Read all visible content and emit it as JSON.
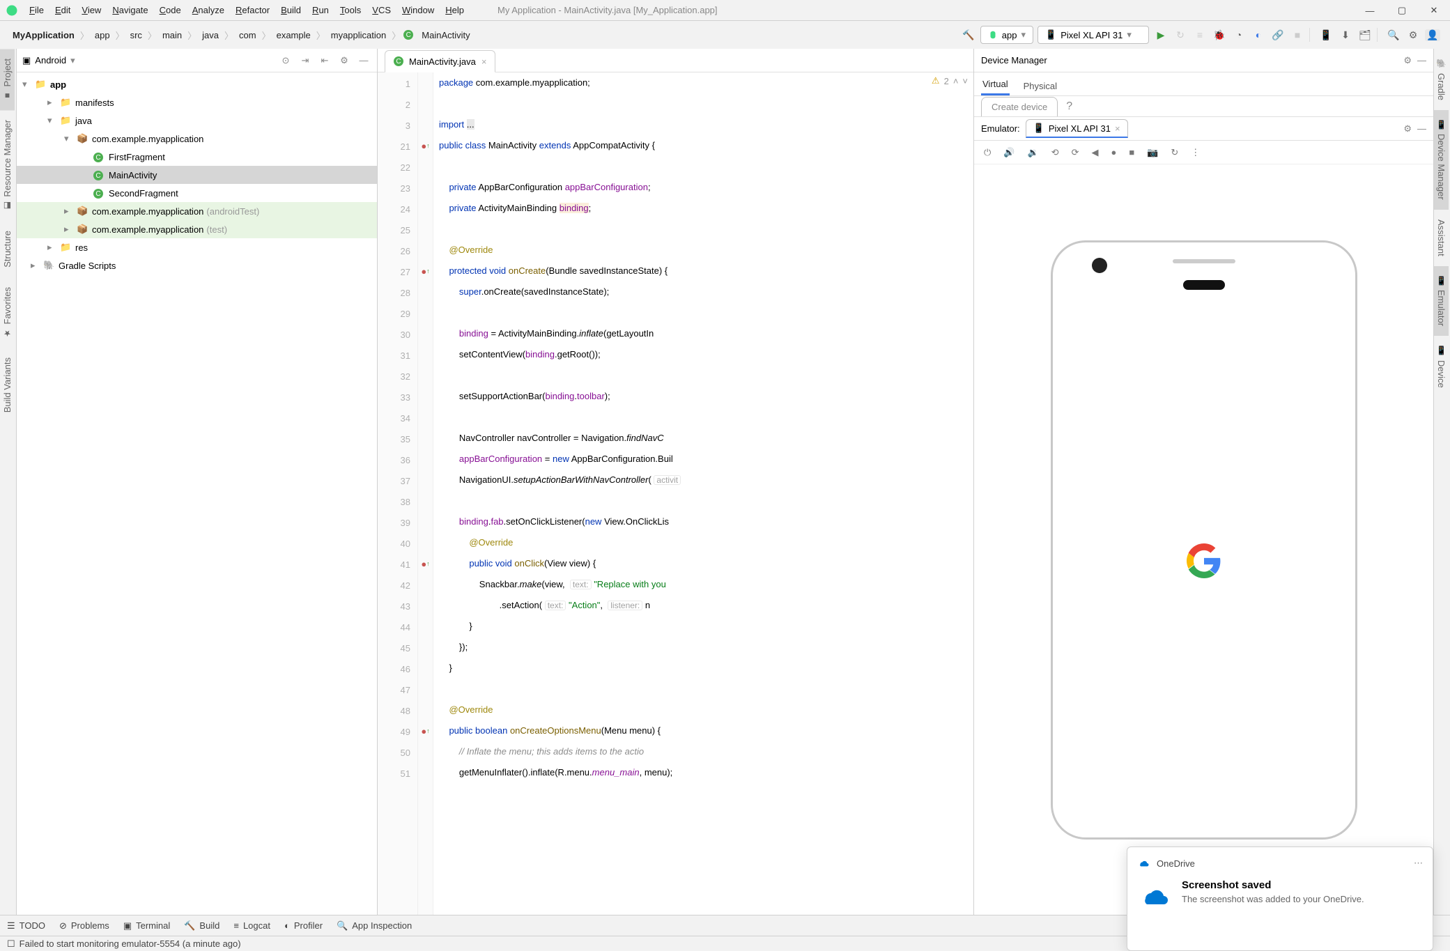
{
  "window_title": "My Application - MainActivity.java [My_Application.app]",
  "menubar": [
    "File",
    "Edit",
    "View",
    "Navigate",
    "Code",
    "Analyze",
    "Refactor",
    "Build",
    "Run",
    "Tools",
    "VCS",
    "Window",
    "Help"
  ],
  "breadcrumbs": [
    "MyApplication",
    "app",
    "src",
    "main",
    "java",
    "com",
    "example",
    "myapplication",
    "MainActivity"
  ],
  "run_config": "app",
  "device_selector": "Pixel XL API 31",
  "project_panel": {
    "title": "Android",
    "tree": {
      "root": "app",
      "nodes": [
        {
          "depth": 1,
          "label": "manifests",
          "icon": "folder"
        },
        {
          "depth": 1,
          "label": "java",
          "icon": "folder",
          "expanded": true
        },
        {
          "depth": 2,
          "label": "com.example.myapplication",
          "icon": "pkg",
          "expanded": true
        },
        {
          "depth": 3,
          "label": "FirstFragment",
          "icon": "class"
        },
        {
          "depth": 3,
          "label": "MainActivity",
          "icon": "class",
          "selected": true
        },
        {
          "depth": 3,
          "label": "SecondFragment",
          "icon": "class"
        },
        {
          "depth": 2,
          "label": "com.example.myapplication",
          "suffix": "(androidTest)",
          "icon": "pkg",
          "green": true
        },
        {
          "depth": 2,
          "label": "com.example.myapplication",
          "suffix": "(test)",
          "icon": "pkg",
          "green": true
        },
        {
          "depth": 1,
          "label": "res",
          "icon": "folder"
        },
        {
          "depth": 0,
          "label": "Gradle Scripts",
          "icon": "gradle"
        }
      ]
    }
  },
  "editor_tab": "MainActivity.java",
  "warning_count": "2",
  "code_lines": [
    {
      "n": "1",
      "html": "<span class='kw'>package</span> com.example.myapplication;"
    },
    {
      "n": "2",
      "html": ""
    },
    {
      "n": "3",
      "html": "<span class='kw'>import</span> <span style='background:#e8e8e8'>...</span>"
    },
    {
      "n": "21",
      "html": "<span class='kw'>public class</span> MainActivity <span class='kw'>extends</span> AppCompatActivity {",
      "mark": "o"
    },
    {
      "n": "22",
      "html": ""
    },
    {
      "n": "23",
      "html": "    <span class='kw'>private</span> AppBarConfiguration <span class='fld'>appBarConfiguration</span>;"
    },
    {
      "n": "24",
      "html": "    <span class='kw'>private</span> ActivityMainBinding <span class='fld' style='background:#fbeedb'>binding</span>;"
    },
    {
      "n": "25",
      "html": ""
    },
    {
      "n": "26",
      "html": "    <span class='ann'>@Override</span>"
    },
    {
      "n": "27",
      "html": "    <span class='kw'>protected void</span> <span class='fn'>onCreate</span>(Bundle savedInstanceState) {",
      "mark": "o"
    },
    {
      "n": "28",
      "html": "        <span class='kw'>super</span>.onCreate(savedInstanceState);"
    },
    {
      "n": "29",
      "html": ""
    },
    {
      "n": "30",
      "html": "        <span class='fld'>binding</span> = ActivityMainBinding.<span style='font-style:italic'>inflate</span>(getLayoutIn"
    },
    {
      "n": "31",
      "html": "        setContentView(<span class='fld'>binding</span>.getRoot());"
    },
    {
      "n": "32",
      "html": ""
    },
    {
      "n": "33",
      "html": "        setSupportActionBar(<span class='fld'>binding</span>.<span class='fld'>toolbar</span>);"
    },
    {
      "n": "34",
      "html": ""
    },
    {
      "n": "35",
      "html": "        NavController navController = Navigation.<span style='font-style:italic'>findNavC</span>"
    },
    {
      "n": "36",
      "html": "        <span class='fld'>appBarConfiguration</span> = <span class='kw'>new</span> AppBarConfiguration.Buil"
    },
    {
      "n": "37",
      "html": "        NavigationUI.<span style='font-style:italic'>setupActionBarWithNavController</span>( <span class='soft'>activit</span>"
    },
    {
      "n": "38",
      "html": ""
    },
    {
      "n": "39",
      "html": "        <span class='fld'>binding</span>.<span class='fld'>fab</span>.setOnClickListener(<span class='kw'>new</span> View.OnClickLis"
    },
    {
      "n": "40",
      "html": "            <span class='ann'>@Override</span>"
    },
    {
      "n": "41",
      "html": "            <span class='kw'>public void</span> <span class='fn'>onClick</span>(View view) {",
      "mark": "o"
    },
    {
      "n": "42",
      "html": "                Snackbar.<span style='font-style:italic'>make</span>(view,  <span class='soft'>text:</span> <span class='str'>\"Replace with you</span>"
    },
    {
      "n": "43",
      "html": "                        .setAction( <span class='soft'>text:</span> <span class='str'>\"Action\"</span>,  <span class='soft'>listener:</span> n"
    },
    {
      "n": "44",
      "html": "            }"
    },
    {
      "n": "45",
      "html": "        });"
    },
    {
      "n": "46",
      "html": "    }"
    },
    {
      "n": "47",
      "html": ""
    },
    {
      "n": "48",
      "html": "    <span class='ann'>@Override</span>"
    },
    {
      "n": "49",
      "html": "    <span class='kw'>public boolean</span> <span class='fn'>onCreateOptionsMenu</span>(Menu menu) {",
      "mark": "o"
    },
    {
      "n": "50",
      "html": "        <span class='com'>// Inflate the menu; this adds items to the actio</span>"
    },
    {
      "n": "51",
      "html": "        getMenuInflater().inflate(R.menu.<span class='fld' style='font-style:italic'>menu_main</span>, menu);"
    }
  ],
  "device_manager": {
    "title": "Device Manager",
    "tabs": [
      "Virtual",
      "Physical"
    ],
    "create_btn": "Create device",
    "emulator_label": "Emulator:",
    "emulator_tab": "Pixel XL API 31"
  },
  "left_tabs": [
    "Project",
    "Resource Manager"
  ],
  "left_tabs_bottom": [
    "Build Variants",
    "Favorites",
    "Structure"
  ],
  "right_tabs": [
    "Gradle",
    "Device Manager",
    "Assistant",
    "Emulator",
    "Device"
  ],
  "bottom_tabs": [
    "TODO",
    "Problems",
    "Terminal",
    "Build",
    "Logcat",
    "Profiler",
    "App Inspection"
  ],
  "status_text": "Failed to start monitoring emulator-5554 (a minute ago)",
  "toast": {
    "app": "OneDrive",
    "title": "Screenshot saved",
    "body": "The screenshot was added to your OneDrive."
  }
}
